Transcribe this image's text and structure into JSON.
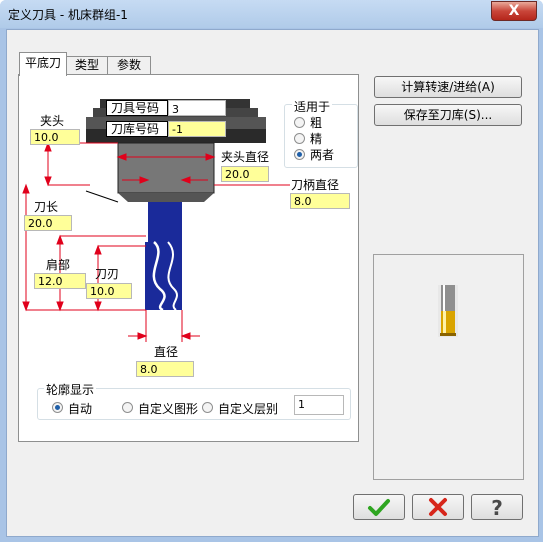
{
  "window": {
    "title": "定义刀具 - 机床群组-1",
    "close_label": "X"
  },
  "tabs": [
    {
      "label": "平底刀",
      "active": true
    },
    {
      "label": "类型",
      "active": false
    },
    {
      "label": "参数",
      "active": false
    }
  ],
  "diagram": {
    "tool_number_label": "刀具号码",
    "tool_number_value": "3",
    "library_number_label": "刀库号码",
    "library_number_value": "-1",
    "holder_label": "夹头",
    "holder_value": "10.0",
    "holder_dia_label": "夹头直径",
    "holder_dia_value": "20.0",
    "shank_dia_label": "刀柄直径",
    "shank_dia_value": "8.0",
    "length_label": "刀长",
    "length_value": "20.0",
    "shoulder_label": "肩部",
    "shoulder_value": "12.0",
    "flute_label": "刀刃",
    "flute_value": "10.0",
    "diameter_label": "直径",
    "diameter_value": "8.0"
  },
  "apply_to": {
    "title": "适用于",
    "options": [
      "粗",
      "精",
      "两者"
    ],
    "selected": "两者"
  },
  "profile": {
    "title": "轮廓显示",
    "options": [
      "自动",
      "自定义图形",
      "自定义层别"
    ],
    "selected": "自动",
    "layer_value": "1"
  },
  "buttons": {
    "calc_feed": "计算转速/进给(A)",
    "save_library": "保存至刀库(S)..."
  },
  "footer": {
    "ok_icon": "checkmark-icon",
    "cancel_icon": "x-icon",
    "help_icon": "question-icon"
  },
  "colors": {
    "accent": "#1a2a9a",
    "dim_red": "#e0001b",
    "field_yellow": "#ffff99"
  }
}
